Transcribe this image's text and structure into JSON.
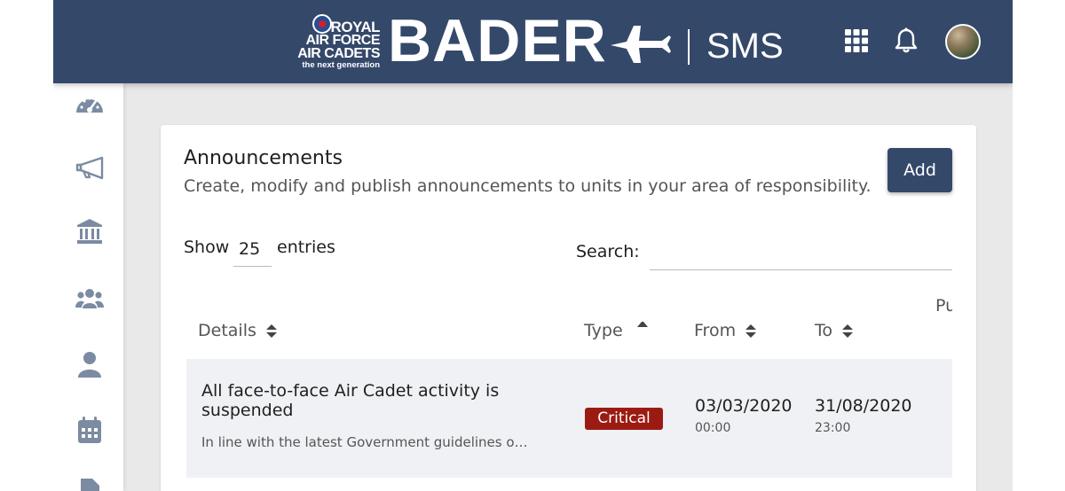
{
  "header": {
    "brand_line1": "ROYAL",
    "brand_line2": "AIR FORCE",
    "brand_line3": "AIR CADETS",
    "brand_tagline": "the next generation",
    "product": "BADER",
    "module": "SMS",
    "background": "#34486a"
  },
  "sidebar": {
    "items": [
      {
        "icon": "dashboard-icon"
      },
      {
        "icon": "megaphone-icon"
      },
      {
        "icon": "institution-icon"
      },
      {
        "icon": "users-icon"
      },
      {
        "icon": "user-icon"
      },
      {
        "icon": "calendar-icon"
      },
      {
        "icon": "document-icon"
      }
    ]
  },
  "page": {
    "title": "Announcements",
    "subtitle": "Create, modify and publish announcements to units in your area of responsibility.",
    "add_label": "Add"
  },
  "table_controls": {
    "show_label": "Show",
    "page_size": "25",
    "entries_label": "entries",
    "search_label": "Search:",
    "search_value": ""
  },
  "table": {
    "columns": {
      "details": "Details",
      "type": "Type",
      "from": "From",
      "to": "To",
      "published_partial": "Pu"
    },
    "rows": [
      {
        "title": "All face-to-face Air Cadet activity is suspended",
        "snippet": "In line with the latest Government guidelines on C…",
        "type": "Critical",
        "from_date": "03/03/2020",
        "from_time": "00:00",
        "to_date": "31/08/2020",
        "to_time": "23:00"
      }
    ]
  },
  "colors": {
    "accent": "#34486a",
    "critical": "#9b1b13"
  }
}
